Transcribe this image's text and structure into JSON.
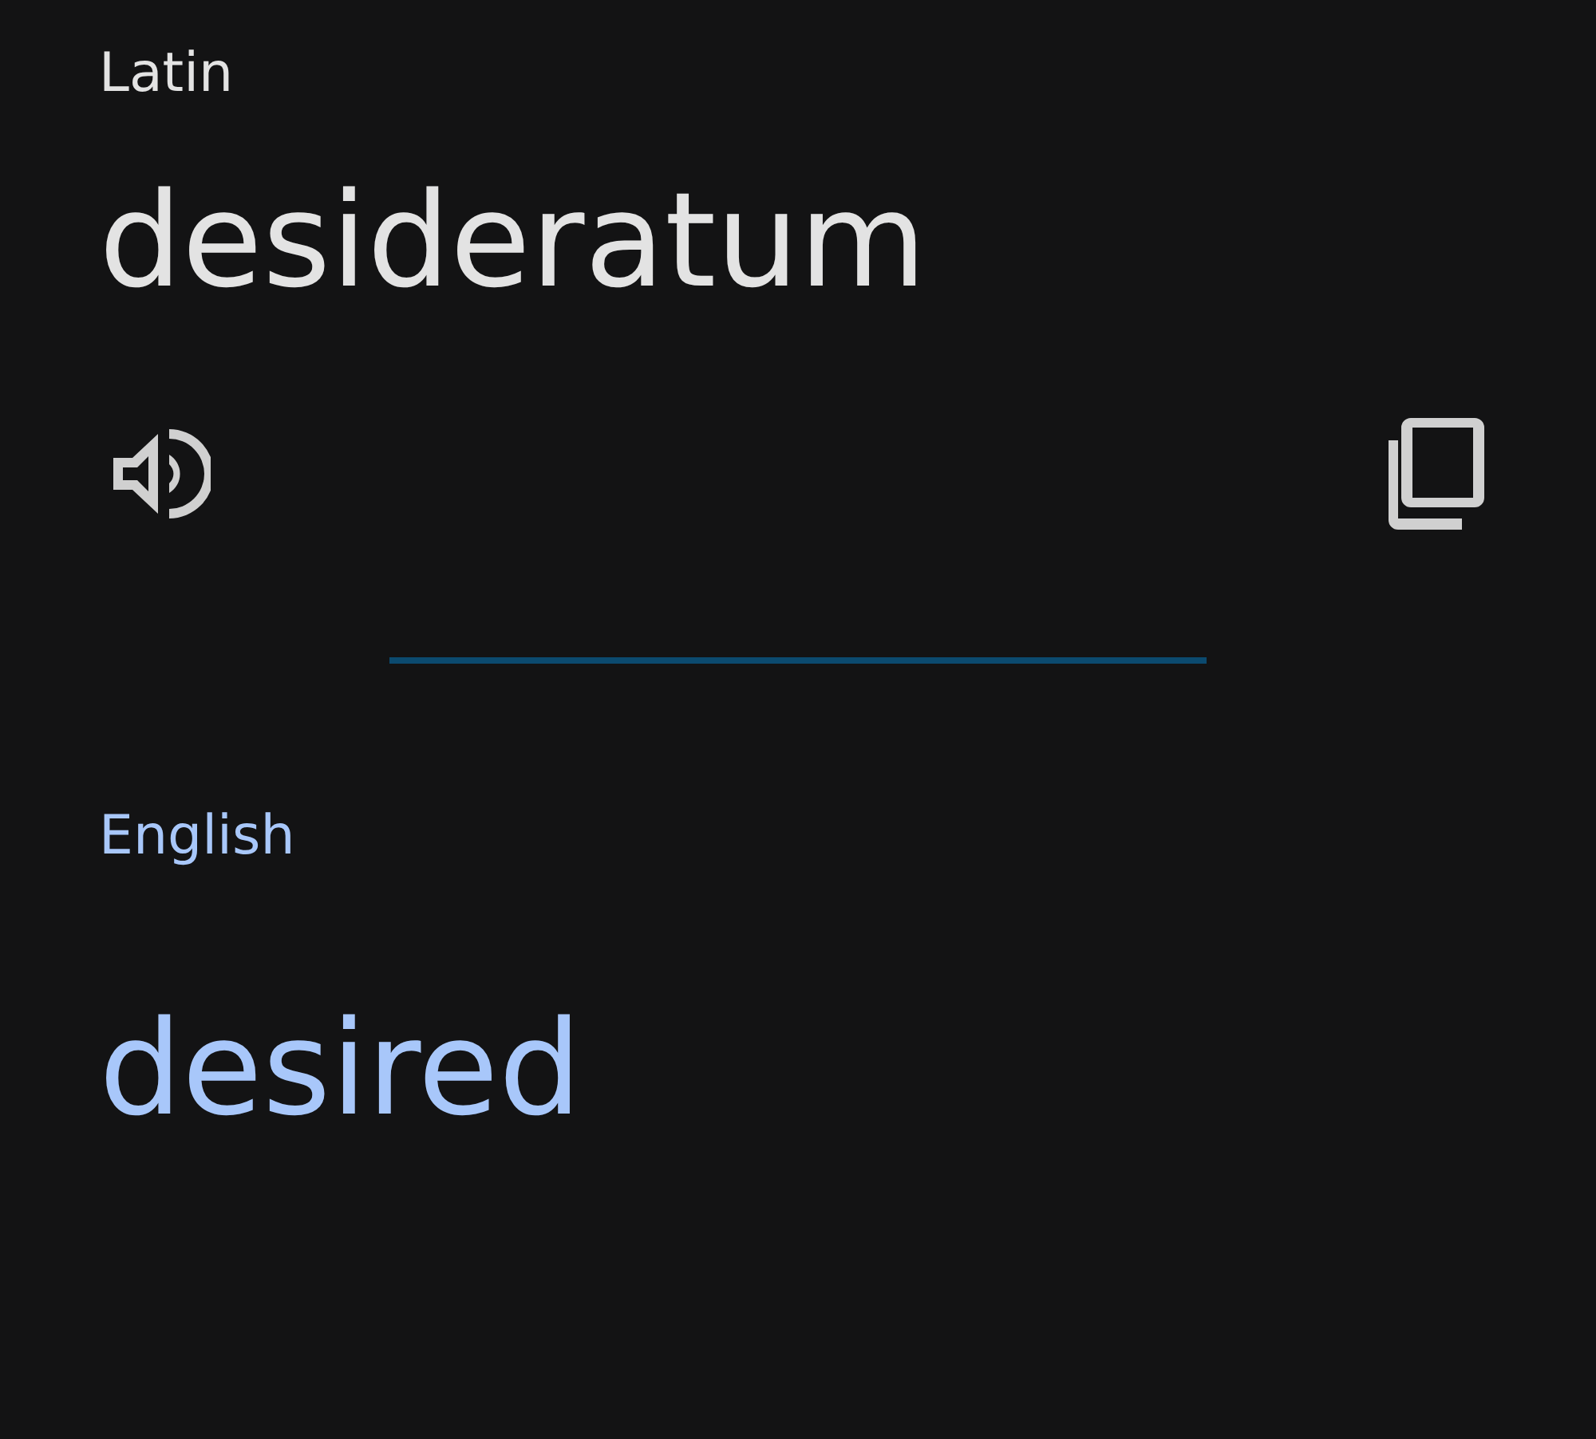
{
  "source": {
    "language": "Latin",
    "text": "desideratum"
  },
  "target": {
    "language": "English",
    "text": "desired"
  }
}
